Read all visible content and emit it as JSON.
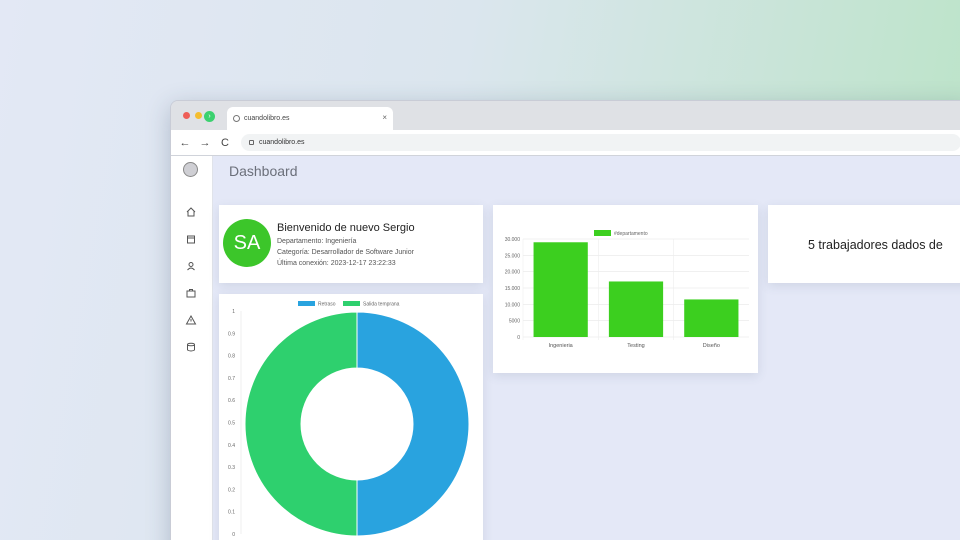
{
  "browser": {
    "tab_title": "cuandolibro.es",
    "url": "cuandolibro.es",
    "close_glyph": "×",
    "nav": {
      "back": "←",
      "forward": "→",
      "reload": "C"
    }
  },
  "sidebar": {
    "toggle_glyph": "›",
    "items": [
      {
        "icon": "home-icon"
      },
      {
        "icon": "calendar-icon"
      },
      {
        "icon": "user-icon"
      },
      {
        "icon": "briefcase-icon"
      },
      {
        "icon": "warning-icon"
      },
      {
        "icon": "database-icon"
      }
    ]
  },
  "page": {
    "title": "Dashboard"
  },
  "profile": {
    "initials": "SA",
    "welcome": "Bienvenido de nuevo Sergio",
    "department": "Departamento: Ingeniería",
    "category": "Categoría: Desarrollador de Software Junior",
    "last_login": "Última conexión: 2023-12-17 23:22:33"
  },
  "workers_card": {
    "text": "5 trabajadores dados de"
  },
  "colors": {
    "green": "#3ccf1f",
    "blue": "#29a3df",
    "donut_green": "#2ed06e",
    "avatar": "#3cc62a"
  },
  "chart_data": [
    {
      "type": "bar",
      "series": [
        {
          "name": "#departamento",
          "values": [
            29000,
            17000,
            11500
          ]
        }
      ],
      "categories": [
        "Ingenieria",
        "Testing",
        "Diseño"
      ],
      "y_ticks": [
        "0",
        "5000",
        "10.000",
        "15.000",
        "20.000",
        "25.000",
        "30.000"
      ],
      "ylim": [
        0,
        30000
      ]
    },
    {
      "type": "pie",
      "donut": true,
      "labels": [
        "Retraso",
        "Salida temprana"
      ],
      "values": [
        50,
        50
      ],
      "y_ticks": [
        "0",
        "0.1",
        "0.2",
        "0.3",
        "0.4",
        "0.5",
        "0.6",
        "0.7",
        "0.8",
        "0.9",
        "1"
      ]
    }
  ]
}
